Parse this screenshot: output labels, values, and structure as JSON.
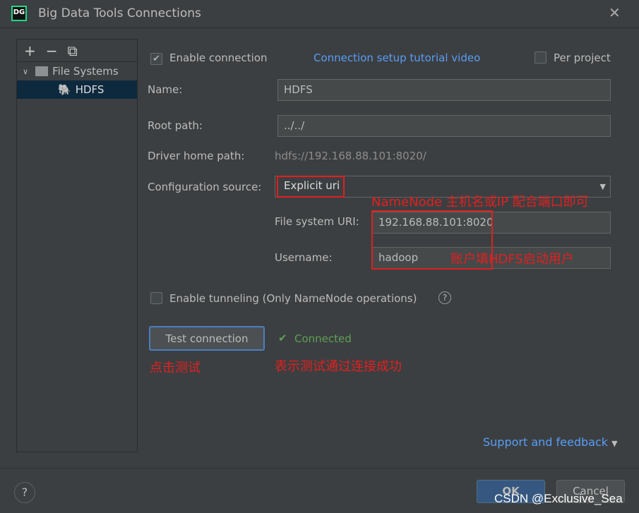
{
  "window": {
    "title": "Big Data Tools Connections",
    "logo": "DG"
  },
  "sidebar": {
    "tools": [
      "+",
      "−",
      "⧉"
    ],
    "group": "File Systems",
    "item": "HDFS"
  },
  "form": {
    "enable_connection": "Enable connection",
    "enable_checked": true,
    "tutorial_link": "Connection setup tutorial video",
    "per_project": "Per project",
    "per_project_checked": false,
    "name_label": "Name:",
    "name_value": "HDFS",
    "root_label": "Root path:",
    "root_value": "../../",
    "driver_label": "Driver home path:",
    "driver_value": "hdfs://192.168.88.101:8020/",
    "config_label": "Configuration source:",
    "config_value": "Explicit uri",
    "uri_label": "File system URI:",
    "uri_value": "192.168.88.101:8020",
    "user_label": "Username:",
    "user_value": "hadoop",
    "tunneling": "Enable tunneling (Only NameNode operations)",
    "tunneling_checked": false,
    "test_button": "Test connection",
    "status": "Connected"
  },
  "annotations": {
    "uri_note": "NameNode 主机名或IP 配合端口即可",
    "user_note": "账户填HDFS启动用户",
    "test_note": "点击测试",
    "status_note": "表示测试通过连接成功"
  },
  "footer": {
    "support": "Support and feedback",
    "ok": "OK",
    "cancel": "Cancel",
    "help": "?"
  },
  "watermark": "CSDN @Exclusive_Sea"
}
